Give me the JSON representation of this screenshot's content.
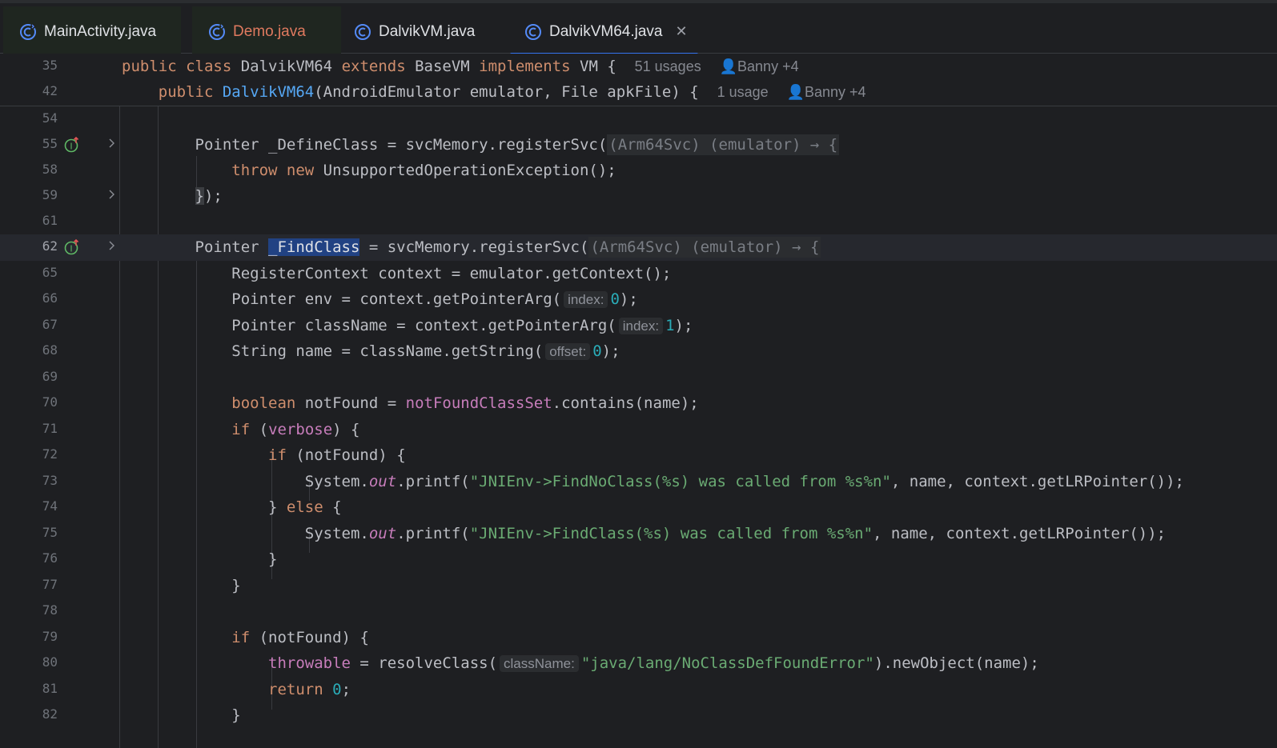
{
  "tabs": [
    {
      "label": "MainActivity.java",
      "icon": "class-icon",
      "active": false,
      "modified": false
    },
    {
      "label": "Demo.java",
      "icon": "class-icon",
      "active": false,
      "modified": true
    },
    {
      "label": "DalvikVM.java",
      "icon": "class-icon",
      "active": false,
      "modified": false
    },
    {
      "label": "DalvikVM64.java",
      "icon": "class-icon",
      "active": true,
      "modified": false
    }
  ],
  "sticky": [
    {
      "num": "35",
      "usages": "51 usages",
      "authors": "Banny +4"
    },
    {
      "num": "42",
      "usages": "1 usage",
      "authors": "Banny +4"
    }
  ],
  "lines": {
    "l54": "54",
    "l55": "55",
    "l58": "58",
    "l59": "59",
    "l61": "61",
    "l62": "62",
    "l65": "65",
    "l66": "66",
    "l67": "67",
    "l68": "68",
    "l69": "69",
    "l70": "70",
    "l71": "71",
    "l72": "72",
    "l73": "73",
    "l74": "74",
    "l75": "75",
    "l76": "76",
    "l77": "77",
    "l78": "78",
    "l79": "79",
    "l80": "80",
    "l81": "81",
    "l82": "82"
  },
  "hints": {
    "index": "index:",
    "offset": "offset:",
    "className": "className:"
  },
  "strings": {
    "findNoClass": "\"JNIEnv->FindNoClass(%s) was called from %s%n\"",
    "findClass": "\"JNIEnv->FindClass(%s) was called from %s%n\"",
    "noClassDef": "\"java/lang/NoClassDefFoundError\""
  },
  "colors": {
    "accent": "#3574f0",
    "background": "#1e1f22",
    "keyword": "#cf8e6d",
    "string": "#6aab73",
    "number": "#2aacb8",
    "field": "#c77dbb",
    "function": "#56a8f5"
  }
}
